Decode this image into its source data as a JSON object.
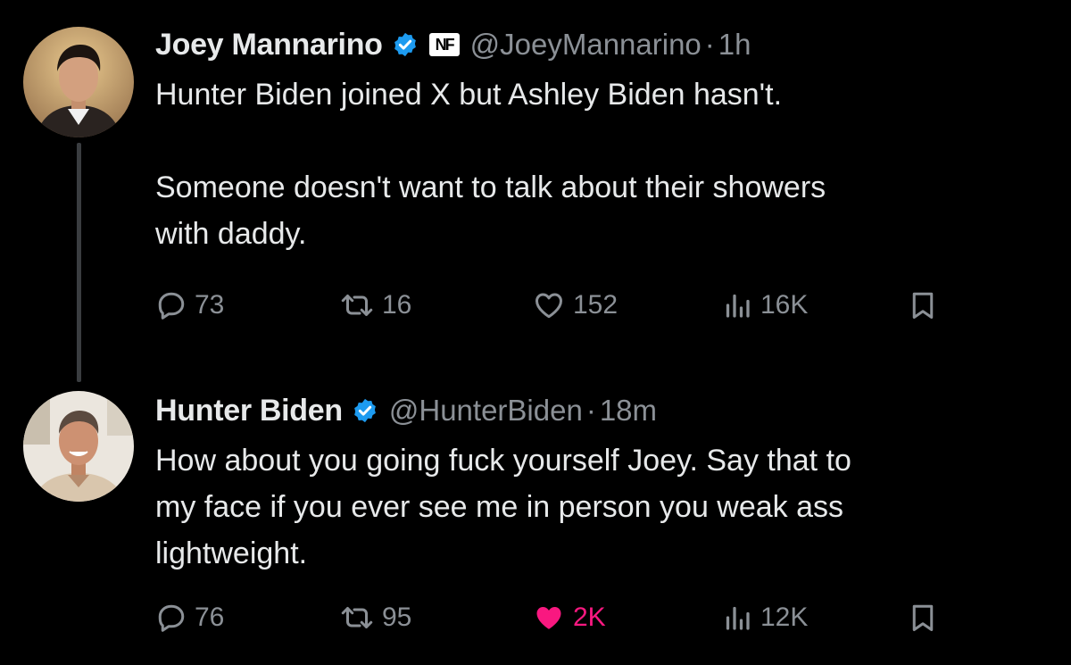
{
  "colors": {
    "background": "#000000",
    "text": "#e7e9ea",
    "muted": "#8b9096",
    "verified": "#1d9bf0",
    "like_active": "#f91880"
  },
  "tweets": [
    {
      "author": {
        "name": "Joey Mannarino",
        "handle": "@JoeyMannarino",
        "badge": "NF",
        "verified": true
      },
      "separator": "·",
      "time": "1h",
      "text_lines": [
        "Hunter Biden joined X but Ashley Biden hasn't.",
        "Someone doesn't want to talk about their showers",
        "with daddy."
      ],
      "stats": {
        "replies": "73",
        "reposts": "16",
        "likes": "152",
        "views": "16K"
      },
      "liked": false,
      "icons": [
        "reply-icon",
        "retweet-icon",
        "heart-icon",
        "views-icon",
        "bookmark-icon"
      ]
    },
    {
      "author": {
        "name": "Hunter Biden",
        "handle": "@HunterBiden",
        "verified": true
      },
      "separator": "·",
      "time": "18m",
      "text_lines": [
        "How about you going fuck yourself Joey. Say that to",
        "my face if you ever see me in person you weak ass",
        "lightweight."
      ],
      "stats": {
        "replies": "76",
        "reposts": "95",
        "likes": "2K",
        "views": "12K"
      },
      "liked": true,
      "icons": [
        "reply-icon",
        "retweet-icon",
        "heart-filled-icon",
        "views-icon",
        "bookmark-icon"
      ]
    }
  ]
}
